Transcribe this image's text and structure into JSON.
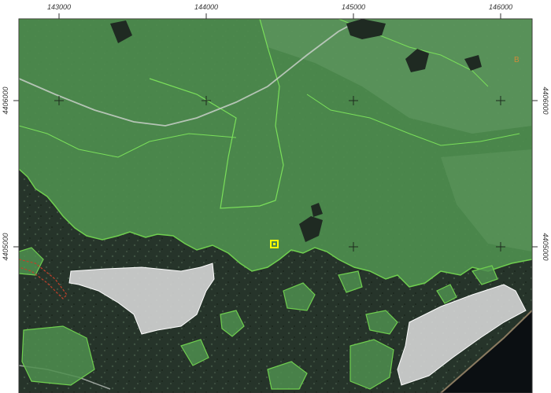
{
  "map": {
    "x_ticks": [
      "143000",
      "144000",
      "145000",
      "146000"
    ],
    "y_ticks": [
      "4406000",
      "4405000"
    ],
    "corner_label": "B",
    "colors": {
      "forest_overlay": "#4f8f4f",
      "overlay_edge": "#6fcf4f",
      "dark_terrain": "#2a3a2c",
      "urban_polygon": "#d9d9d9",
      "sea": "#0b0f12",
      "marker": "#ffff00",
      "road": "#cfd3cf"
    }
  }
}
